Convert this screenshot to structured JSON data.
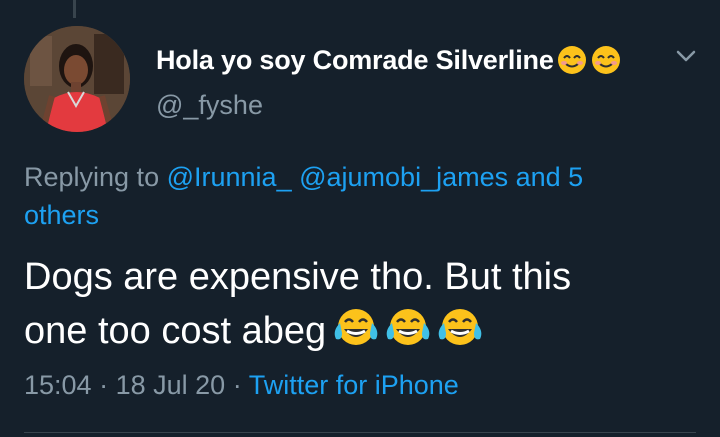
{
  "tweet": {
    "display_name": "Hola yo soy Comrade Silverline",
    "name_emojis": [
      "smiling-face-emoji",
      "smiling-face-emoji"
    ],
    "handle": "@_fyshe",
    "replying_prefix": "Replying to",
    "mention_1": "@Irunnia_",
    "mention_2": "@ajumobi_james",
    "others": "and 5 others",
    "text_line_1": "Dogs are expensive tho. But this",
    "text_line_2": "one too cost abeg",
    "text_emojis": [
      "tears-of-joy-emoji",
      "tears-of-joy-emoji",
      "tears-of-joy-emoji"
    ],
    "time": "15:04",
    "separator": "·",
    "date": "18 Jul 20",
    "source": "Twitter for iPhone"
  },
  "icons": {
    "menu": "chevron-down-icon",
    "avatar": "profile-photo"
  },
  "colors": {
    "background": "#15202b",
    "text": "#ffffff",
    "secondary": "#8899a6",
    "link": "#1da1f2",
    "divider": "#38444d"
  }
}
